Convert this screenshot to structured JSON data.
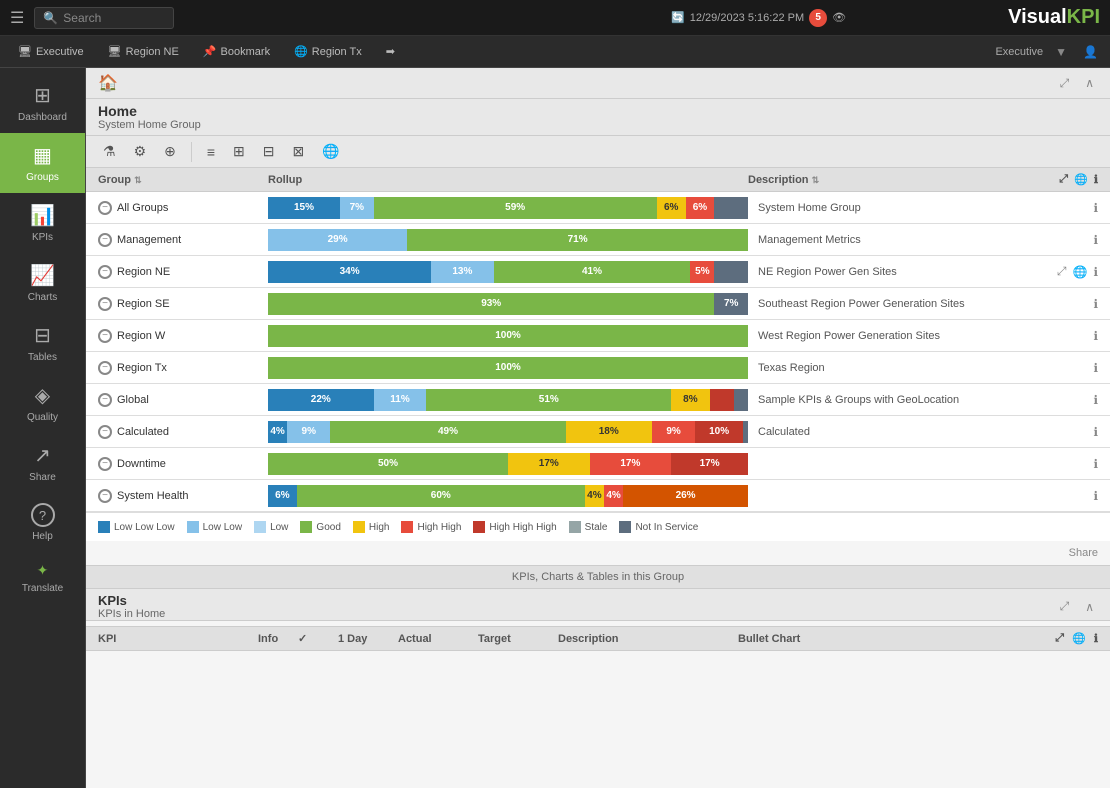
{
  "app": {
    "name": "Visual",
    "name_accent": "KPI",
    "logo": "VisualKPI"
  },
  "topbar": {
    "search_placeholder": "Search",
    "datetime": "12/29/2023 5:16:22 PM",
    "alert_count": "5",
    "user_label": "Executive"
  },
  "tabs": [
    {
      "id": "executive",
      "label": "Executive",
      "icon": "🖥"
    },
    {
      "id": "region-ne",
      "label": "Region NE",
      "icon": "🖥"
    },
    {
      "id": "bookmark",
      "label": "Bookmark",
      "icon": "📌"
    },
    {
      "id": "region-tx",
      "label": "Region Tx",
      "icon": "🌐"
    },
    {
      "id": "more",
      "label": "",
      "icon": "➡"
    }
  ],
  "sidebar": {
    "items": [
      {
        "id": "dashboard",
        "label": "Dashboard",
        "icon": "⊞"
      },
      {
        "id": "groups",
        "label": "Groups",
        "icon": "▦",
        "active": true
      },
      {
        "id": "kpis",
        "label": "KPIs",
        "icon": "📊"
      },
      {
        "id": "charts",
        "label": "Charts",
        "icon": "📈"
      },
      {
        "id": "tables",
        "label": "Tables",
        "icon": "⊟"
      },
      {
        "id": "quality",
        "label": "Quality",
        "icon": "◈"
      },
      {
        "id": "share",
        "label": "Share",
        "icon": "↗"
      },
      {
        "id": "help",
        "label": "Help",
        "icon": "?"
      },
      {
        "id": "translate",
        "label": "Translate",
        "icon": "✦"
      }
    ]
  },
  "breadcrumb": {
    "title": "Home",
    "subtitle": "System Home Group"
  },
  "table": {
    "columns": {
      "group": "Group",
      "rollup": "Rollup",
      "description": "Description"
    },
    "rows": [
      {
        "name": "All Groups",
        "type": "minus",
        "desc": "System Home Group",
        "segments": [
          {
            "pct": 15,
            "class": "bar-blue-dark",
            "label": "15%"
          },
          {
            "pct": 7,
            "class": "bar-blue-light",
            "label": "7%"
          },
          {
            "pct": 59,
            "class": "bar-green",
            "label": "59%"
          },
          {
            "pct": 6,
            "class": "bar-yellow",
            "label": "6%"
          },
          {
            "pct": 6,
            "class": "bar-red-light",
            "label": "6%"
          },
          {
            "pct": 7,
            "class": "bar-dark-gray",
            "label": ""
          }
        ]
      },
      {
        "name": "Management",
        "type": "minus",
        "desc": "Management Metrics",
        "segments": [
          {
            "pct": 29,
            "class": "bar-blue-light",
            "label": "29%"
          },
          {
            "pct": 71,
            "class": "bar-green",
            "label": "71%"
          }
        ]
      },
      {
        "name": "Region NE",
        "type": "minus",
        "desc": "NE Region Power Gen Sites",
        "segments": [
          {
            "pct": 34,
            "class": "bar-blue-dark",
            "label": "34%"
          },
          {
            "pct": 13,
            "class": "bar-blue-light",
            "label": "13%"
          },
          {
            "pct": 41,
            "class": "bar-green",
            "label": "41%"
          },
          {
            "pct": 5,
            "class": "bar-red-light",
            "label": "5%"
          },
          {
            "pct": 7,
            "class": "bar-dark-gray",
            "label": ""
          }
        ]
      },
      {
        "name": "Region SE",
        "type": "minus",
        "desc": "Southeast Region Power Generation Sites",
        "segments": [
          {
            "pct": 93,
            "class": "bar-green",
            "label": "93%"
          },
          {
            "pct": 7,
            "class": "bar-dark-gray",
            "label": "7%"
          }
        ]
      },
      {
        "name": "Region W",
        "type": "minus",
        "desc": "West Region Power Generation Sites",
        "segments": [
          {
            "pct": 100,
            "class": "bar-green",
            "label": "100%"
          }
        ]
      },
      {
        "name": "Region Tx",
        "type": "minus",
        "desc": "Texas Region",
        "segments": [
          {
            "pct": 100,
            "class": "bar-green",
            "label": "100%"
          }
        ]
      },
      {
        "name": "Global",
        "type": "minus",
        "desc": "Sample KPIs & Groups with GeoLocation",
        "segments": [
          {
            "pct": 22,
            "class": "bar-blue-dark",
            "label": "22%"
          },
          {
            "pct": 11,
            "class": "bar-blue-light",
            "label": "11%"
          },
          {
            "pct": 51,
            "class": "bar-green",
            "label": "51%"
          },
          {
            "pct": 8,
            "class": "bar-yellow",
            "label": "8%"
          },
          {
            "pct": 5,
            "class": "bar-red-dark",
            "label": ""
          },
          {
            "pct": 3,
            "class": "bar-dark-gray",
            "label": ""
          }
        ]
      },
      {
        "name": "Calculated",
        "type": "minus",
        "desc": "Calculated",
        "segments": [
          {
            "pct": 4,
            "class": "bar-blue-dark",
            "label": "4%"
          },
          {
            "pct": 9,
            "class": "bar-blue-light",
            "label": "9%"
          },
          {
            "pct": 49,
            "class": "bar-green",
            "label": "49%"
          },
          {
            "pct": 18,
            "class": "bar-yellow",
            "label": "18%"
          },
          {
            "pct": 9,
            "class": "bar-red-light",
            "label": "9%"
          },
          {
            "pct": 10,
            "class": "bar-red-dark",
            "label": "10%"
          },
          {
            "pct": 1,
            "class": "bar-dark-gray",
            "label": ""
          }
        ]
      },
      {
        "name": "Downtime",
        "type": "minus",
        "desc": "",
        "segments": [
          {
            "pct": 50,
            "class": "bar-green",
            "label": "50%"
          },
          {
            "pct": 17,
            "class": "bar-yellow",
            "label": "17%"
          },
          {
            "pct": 17,
            "class": "bar-red-light",
            "label": "17%"
          },
          {
            "pct": 16,
            "class": "bar-red-dark",
            "label": "17%"
          }
        ]
      },
      {
        "name": "System Health",
        "type": "minus",
        "desc": "",
        "segments": [
          {
            "pct": 6,
            "class": "bar-blue-dark",
            "label": "6%"
          },
          {
            "pct": 60,
            "class": "bar-green",
            "label": "60%"
          },
          {
            "pct": 4,
            "class": "bar-yellow",
            "label": "4%"
          },
          {
            "pct": 4,
            "class": "bar-red-light",
            "label": "4%"
          },
          {
            "pct": 26,
            "class": "bar-orange",
            "label": "26%"
          }
        ]
      }
    ]
  },
  "legend": [
    {
      "label": "Low Low Low",
      "color": "#2980b9"
    },
    {
      "label": "Low Low",
      "color": "#85c1e9"
    },
    {
      "label": "Low",
      "color": "#aed6f1"
    },
    {
      "label": "Good",
      "color": "#7ab648"
    },
    {
      "label": "High",
      "color": "#f1c40f"
    },
    {
      "label": "High High",
      "color": "#e74c3c"
    },
    {
      "label": "High High High",
      "color": "#c0392b"
    },
    {
      "label": "Stale",
      "color": "#95a5a6"
    },
    {
      "label": "Not In Service",
      "color": "#5d6d7e"
    }
  ],
  "share_label": "Share",
  "section_divider": "KPIs, Charts & Tables in this Group",
  "kpis_section": {
    "title": "KPIs",
    "subtitle": "KPIs in Home",
    "columns": [
      "KPI",
      "Info",
      "✓",
      "1 Day",
      "Actual",
      "Target",
      "Description",
      "Bullet Chart"
    ]
  }
}
